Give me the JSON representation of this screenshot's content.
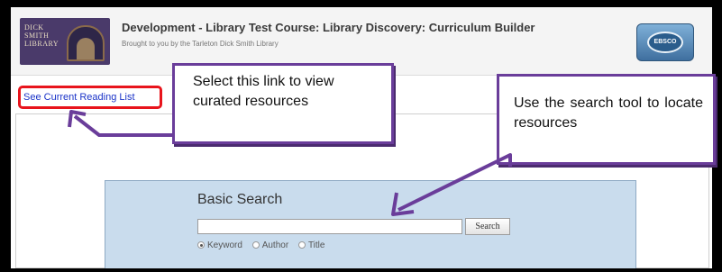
{
  "header": {
    "logo_text": "DICK\nSMITH\nLIBRARY",
    "title": "Development - Library Test Course: Library Discovery: Curriculum Builder",
    "subtitle": "Brought to you by the Tarleton Dick Smith Library",
    "partner_logo_text": "EBSCO"
  },
  "reading_list": {
    "link_text": "See Current Reading List"
  },
  "search": {
    "title": "Basic Search",
    "input_value": "",
    "button_label": "Search",
    "options": [
      {
        "label": "Keyword",
        "checked": true
      },
      {
        "label": "Author",
        "checked": false
      },
      {
        "label": "Title",
        "checked": false
      }
    ]
  },
  "callouts": {
    "reading_list": "Select this link to view curated resources",
    "search_tool": "Use the search tool to locate resources"
  },
  "colors": {
    "callout_border": "#6a3d9a",
    "highlight_border": "#e8141c",
    "link": "#1a33c8",
    "search_panel": "#c9dced"
  }
}
